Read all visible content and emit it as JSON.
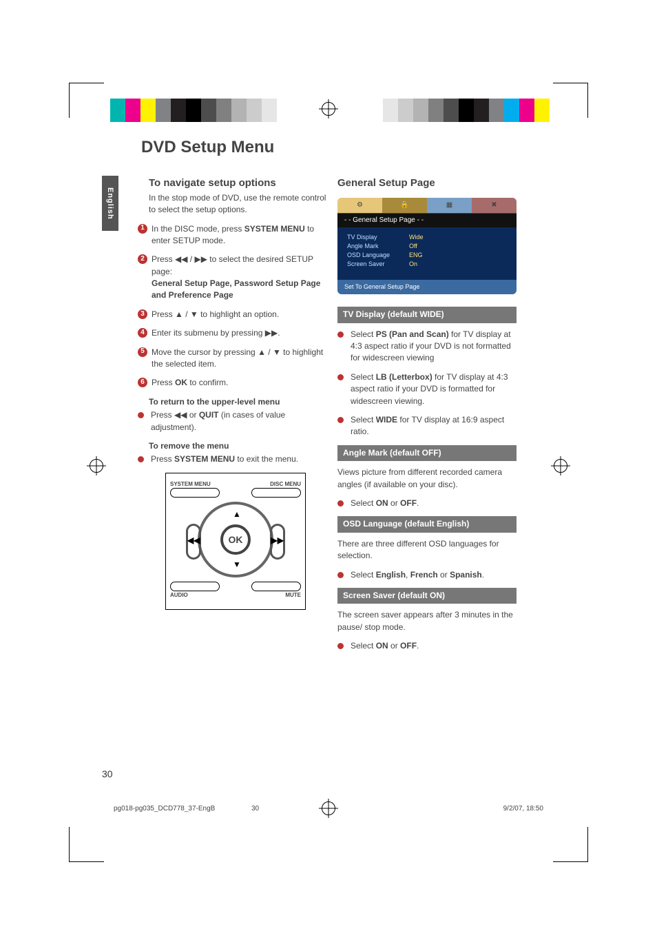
{
  "page": {
    "title": "DVD Setup Menu",
    "language_tab": "English",
    "number": "30"
  },
  "left": {
    "nav_heading": "To navigate setup options",
    "nav_intro": "In the stop mode of DVD, use the remote control to select the setup options.",
    "steps": {
      "s1a": "In the DISC mode, press ",
      "s1b": "SYSTEM MENU",
      "s1c": " to enter SETUP mode.",
      "s2a": "Press ",
      "s2sym": "◀◀ /  ▶▶",
      "s2b": " to select the desired  SETUP page:",
      "s2bold": "General Setup Page, Password Setup Page and Preference Page",
      "s3": "Press  ▲ / ▼ to highlight an option.",
      "s4a": "Enter its submenu by pressing  ",
      "s4sym": "▶▶",
      "s4b": ".",
      "s5": "Move the cursor by pressing   ▲ / ▼  to highlight the selected item.",
      "s6a": "Press ",
      "s6b": "OK",
      "s6c": " to confirm."
    },
    "return_head": "To return to the upper-level menu",
    "return_a": "Press ",
    "return_sym": "◀◀",
    "return_b": " or ",
    "return_c": "QUIT",
    "return_d": " (in cases of value adjustment).",
    "remove_head": "To remove the menu",
    "remove_a": "Press ",
    "remove_b": "SYSTEM MENU",
    "remove_c": " to exit the menu."
  },
  "remote": {
    "top_left": "SYSTEM MENU",
    "top_right": "DISC MENU",
    "ok": "OK",
    "bot_left": "AUDIO",
    "bot_right": "MUTE"
  },
  "right": {
    "heading": "General Setup Page",
    "screenshot": {
      "title": "- -  General Setup Page  - -",
      "rows": [
        {
          "k": "TV Display",
          "v": "Wide"
        },
        {
          "k": "Angle Mark",
          "v": "Off"
        },
        {
          "k": "OSD Language",
          "v": "ENG"
        },
        {
          "k": "Screen Saver",
          "v": "On"
        }
      ],
      "footer": "Set To General Setup Page"
    },
    "tv": {
      "bar": "TV Display (default WIDE)",
      "ps_a": "Select ",
      "ps_b": "PS (Pan and Scan)",
      "ps_c": " for TV display at 4:3 aspect ratio if your DVD is not formatted for widescreen viewing",
      "lb_a": "Select ",
      "lb_b": "LB (Letterbox)",
      "lb_c": " for TV display at 4:3 aspect ratio if your DVD is formatted for widescreen viewing.",
      "wd_a": "Select ",
      "wd_b": "WIDE",
      "wd_c": " for TV display at 16:9 aspect ratio."
    },
    "angle": {
      "bar": "Angle  Mark  (default OFF)",
      "desc": "Views picture from different recorded camera angles (if available on your disc).",
      "sel_a": "Select ",
      "sel_b": "ON",
      "sel_c": " or ",
      "sel_d": "OFF",
      "sel_e": "."
    },
    "osd": {
      "bar": "OSD Language (default English)",
      "desc": "There are three different OSD languages for selection.",
      "sel_a": "Select ",
      "sel_b": "English",
      "sel_c": ", ",
      "sel_d": "French",
      "sel_e": " or ",
      "sel_f": "Spanish",
      "sel_g": "."
    },
    "ss": {
      "bar": "Screen Saver (default ON)",
      "desc": "The screen saver appears after 3 minutes in the pause/ stop mode.",
      "sel_a": "Select ",
      "sel_b": "ON",
      "sel_c": " or ",
      "sel_d": "OFF",
      "sel_e": "."
    }
  },
  "footer": {
    "file": "pg018-pg035_DCD778_37-EngB",
    "page": "30",
    "date": "9/2/07, 18:50"
  },
  "colorbars_left": [
    "#00b5b0",
    "#ec008c",
    "#fff200",
    "#808285",
    "#231f20",
    "#000000",
    "#4d4d4d",
    "#808080",
    "#b3b3b3",
    "#cccccc",
    "#e6e6e6",
    "#ffffff"
  ],
  "colorbars_right": [
    "#ffffff",
    "#e6e6e6",
    "#cccccc",
    "#b3b3b3",
    "#808080",
    "#4d4d4d",
    "#000000",
    "#231f20",
    "#808285",
    "#00aeef",
    "#ec008c",
    "#fff200"
  ]
}
